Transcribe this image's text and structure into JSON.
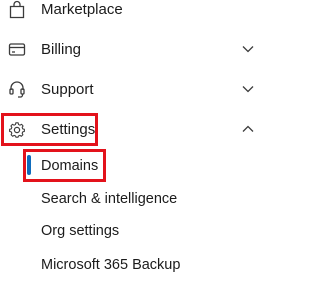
{
  "nav": {
    "items": [
      {
        "label": "Marketplace",
        "icon": "shopping-bag-icon",
        "expandable": false
      },
      {
        "label": "Billing",
        "icon": "credit-card-icon",
        "expandable": true,
        "expanded": false
      },
      {
        "label": "Support",
        "icon": "headset-icon",
        "expandable": true,
        "expanded": false
      },
      {
        "label": "Settings",
        "icon": "gear-icon",
        "expandable": true,
        "expanded": true
      }
    ],
    "settings_children": [
      {
        "label": "Domains",
        "selected": true
      },
      {
        "label": "Search & intelligence",
        "selected": false
      },
      {
        "label": "Org settings",
        "selected": false
      },
      {
        "label": "Microsoft 365 Backup",
        "selected": false
      }
    ]
  },
  "colors": {
    "text": "#1b1b1b",
    "icon": "#3b3b3b",
    "selected_indicator": "#0f6cbd",
    "annotation_box": "#e3121b"
  }
}
